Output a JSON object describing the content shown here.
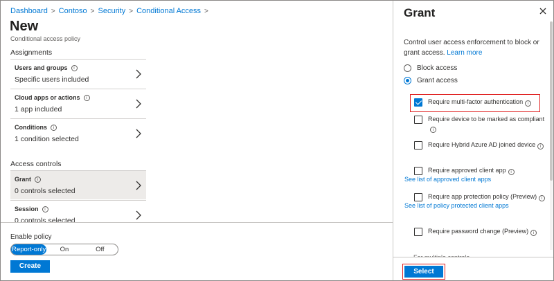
{
  "breadcrumb": [
    "Dashboard",
    "Contoso",
    "Security",
    "Conditional Access"
  ],
  "page": {
    "title": "New",
    "subtitle": "Conditional access policy"
  },
  "assignments": {
    "label": "Assignments",
    "cards": [
      {
        "title": "Users and groups",
        "value": "Specific users included"
      },
      {
        "title": "Cloud apps or actions",
        "value": "1 app included"
      },
      {
        "title": "Conditions",
        "value": "1 condition selected"
      }
    ]
  },
  "access_controls": {
    "label": "Access controls",
    "cards": [
      {
        "title": "Grant",
        "value": "0 controls selected"
      },
      {
        "title": "Session",
        "value": "0 controls selected"
      }
    ]
  },
  "enable_policy": {
    "label": "Enable policy",
    "options": [
      "Report-only",
      "On",
      "Off"
    ],
    "selected": "Report-only"
  },
  "create_label": "Create",
  "blade": {
    "title": "Grant",
    "description": "Control user access enforcement to block or grant access.",
    "learn_more": "Learn more",
    "radios": [
      {
        "label": "Block access",
        "checked": false
      },
      {
        "label": "Grant access",
        "checked": true
      }
    ],
    "checkboxes": [
      {
        "label": "Require multi-factor authentication",
        "checked": true
      },
      {
        "label": "Require device to be marked as compliant",
        "checked": false
      },
      {
        "label": "Require Hybrid Azure AD joined device",
        "checked": false
      },
      {
        "label": "Require approved client app",
        "checked": false,
        "link": "See list of approved client apps"
      },
      {
        "label": "Require app protection policy (Preview)",
        "checked": false,
        "link": "See list of policy protected client apps"
      },
      {
        "label": "Require password change (Preview)",
        "checked": false
      }
    ],
    "truncated_text": "For multiple controls",
    "select_label": "Select"
  },
  "colors": {
    "accent": "#0078d4",
    "highlight": "#e02020"
  }
}
